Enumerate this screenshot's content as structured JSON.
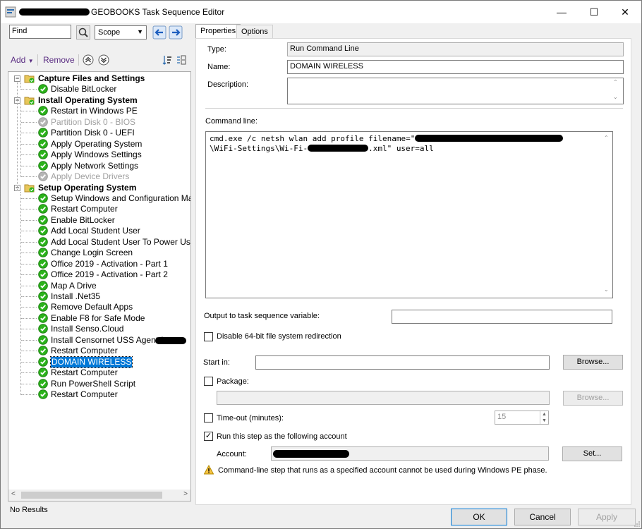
{
  "window": {
    "title": "GEOBOOKS Task Sequence Editor",
    "minimize": "—",
    "maximize": "☐",
    "close": "✕"
  },
  "left": {
    "find_placeholder": "Find",
    "find_value": "Find",
    "scope": "Scope",
    "add_label": "Add",
    "remove_label": "Remove",
    "status": "No Results"
  },
  "tree": [
    {
      "label": "Capture Files and Settings",
      "type": "group",
      "level": 0
    },
    {
      "label": "Disable BitLocker",
      "type": "step",
      "level": 1
    },
    {
      "label": "Install Operating System",
      "type": "group",
      "level": 0
    },
    {
      "label": "Restart in Windows PE",
      "type": "step",
      "level": 1
    },
    {
      "label": "Partition Disk 0 - BIOS",
      "type": "step",
      "level": 1,
      "disabled": true
    },
    {
      "label": "Partition Disk 0 - UEFI",
      "type": "step",
      "level": 1
    },
    {
      "label": "Apply Operating System",
      "type": "step",
      "level": 1
    },
    {
      "label": "Apply Windows Settings",
      "type": "step",
      "level": 1
    },
    {
      "label": "Apply Network Settings",
      "type": "step",
      "level": 1
    },
    {
      "label": "Apply Device Drivers",
      "type": "step",
      "level": 1,
      "disabled": true
    },
    {
      "label": "Setup Operating System",
      "type": "group",
      "level": 0
    },
    {
      "label": "Setup Windows and Configuration Manager",
      "type": "step",
      "level": 1
    },
    {
      "label": "Restart Computer",
      "type": "step",
      "level": 1
    },
    {
      "label": "Enable BitLocker",
      "type": "step",
      "level": 1
    },
    {
      "label": "Add Local Student User",
      "type": "step",
      "level": 1
    },
    {
      "label": "Add Local Student User To Power Users",
      "type": "step",
      "level": 1
    },
    {
      "label": "Change Login Screen",
      "type": "step",
      "level": 1
    },
    {
      "label": "Office 2019 - Activation - Part 1",
      "type": "step",
      "level": 1
    },
    {
      "label": "Office 2019 - Activation - Part 2",
      "type": "step",
      "level": 1
    },
    {
      "label": "Map A Drive",
      "type": "step",
      "level": 1
    },
    {
      "label": "Install .Net35",
      "type": "step",
      "level": 1
    },
    {
      "label": "Remove Default Apps",
      "type": "step",
      "level": 1
    },
    {
      "label": "Enable F8 for Safe Mode",
      "type": "step",
      "level": 1
    },
    {
      "label": "Install Senso.Cloud",
      "type": "step",
      "level": 1
    },
    {
      "label": "Install Censornet USS Agent for",
      "type": "step",
      "level": 1
    },
    {
      "label": "Restart Computer",
      "type": "step",
      "level": 1
    },
    {
      "label": "DOMAIN WIRELESS",
      "type": "step",
      "level": 1,
      "selected": true
    },
    {
      "label": "Restart Computer",
      "type": "step",
      "level": 1
    },
    {
      "label": "Run PowerShell Script",
      "type": "step",
      "level": 1
    },
    {
      "label": "Restart Computer",
      "type": "step",
      "level": 1
    }
  ],
  "tabs": [
    {
      "label": "Properties",
      "active": true
    },
    {
      "label": "Options",
      "active": false
    }
  ],
  "props": {
    "type_label": "Type:",
    "type_value": "Run Command Line",
    "name_label": "Name:",
    "name_value": "DOMAIN WIRELESS",
    "desc_label": "Description:",
    "desc_value": "",
    "cmd_label": "Command line:",
    "cmd_line1": "cmd.exe /c netsh wlan add profile filename=\"",
    "cmd_line2a": "\\WiFi-Settings\\Wi-Fi-",
    "cmd_line2b": ".xml\" user=all",
    "output_label": "Output to task sequence variable:",
    "output_value": "",
    "disable64_label": "Disable 64-bit file system redirection",
    "startin_label": "Start in:",
    "startin_value": "",
    "browse1": "Browse...",
    "package_label": "Package:",
    "package_value": "",
    "browse2": "Browse...",
    "timeout_label": "Time-out (minutes):",
    "timeout_value": "15",
    "runas_label": "Run this step as the following account",
    "account_label": "Account:",
    "set_label": "Set...",
    "warning": "Command-line step that runs as a specified account cannot be used during Windows PE phase."
  },
  "footer": {
    "ok": "OK",
    "cancel": "Cancel",
    "apply": "Apply"
  },
  "colors": {
    "selection": "#0078d7",
    "step_check": "#2bb31b",
    "disabled_check": "#b5b5b5",
    "folder": "#e8c75a"
  }
}
